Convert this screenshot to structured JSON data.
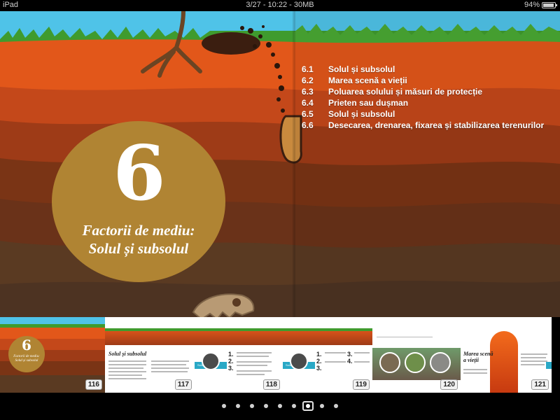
{
  "status_bar": {
    "device": "iPad",
    "info": "3/27 - 10:22 - 30MB",
    "battery": "94%",
    "battery_level": 0.94
  },
  "chapter": {
    "number": "6",
    "title_line1": "Factorii de mediu:",
    "title_line2": "Solul și subsolul"
  },
  "toc": [
    {
      "num": "6.1",
      "text": "Solul și subsolul"
    },
    {
      "num": "6.2",
      "text": "Marea scenă a vieții"
    },
    {
      "num": "6.3",
      "text": "Poluarea solului și măsuri de protecție"
    },
    {
      "num": "6.4",
      "text": "Prieten sau dușman"
    },
    {
      "num": "6.5",
      "text": "Solul și subsolul"
    },
    {
      "num": "6.6",
      "text": "Desecarea, drenarea, fixarea și stabilizarea terenurilor"
    }
  ],
  "thumbnails": [
    {
      "page": "116",
      "mini_number": "6",
      "mini_title": "Factorii de mediu: Solul și subsolul"
    },
    {
      "page": "117",
      "mini_title": "Solul și subsolul"
    },
    {
      "page": "118",
      "mini_badge": "Solul nu este"
    },
    {
      "page": "119",
      "mini_badge": "Solul este"
    },
    {
      "page": "120"
    },
    {
      "page": "121",
      "mini_title": "Marea scenă a vieții"
    }
  ],
  "pager": {
    "dot_count": 9,
    "active_index": 6
  },
  "colors": {
    "sky": "#4fc3e8",
    "grass": "#3f9b2e",
    "chapter_circle": "#b08433",
    "teal_accent": "#29a8c6",
    "soil_top": "#e2571a"
  }
}
